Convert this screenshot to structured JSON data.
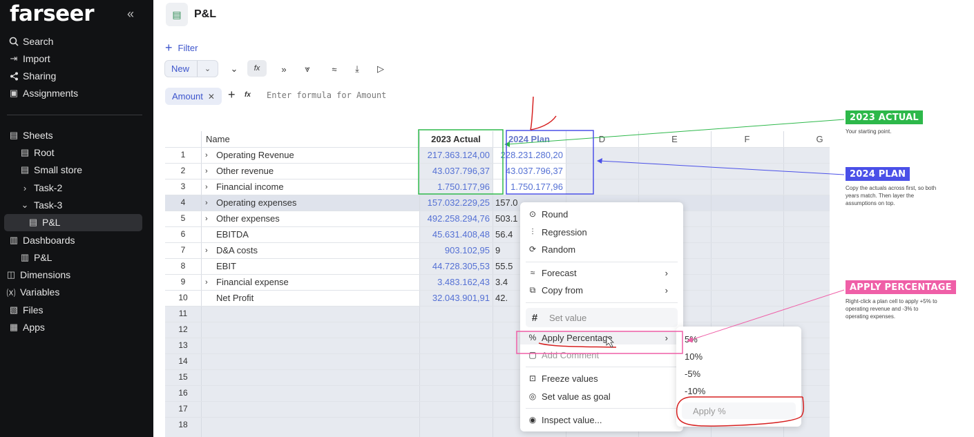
{
  "sidebar": {
    "logo": "farseer",
    "top_items": [
      "Search",
      "Import",
      "Sharing",
      "Assignments"
    ],
    "tree": [
      {
        "label": "Sheets",
        "icon": "sheet-icon"
      },
      {
        "label": "Root",
        "icon": "sheet-icon"
      },
      {
        "label": "Small store",
        "icon": "sheet-icon"
      },
      {
        "label": "Task-2",
        "icon": "chevron-right-icon"
      },
      {
        "label": "Task-3",
        "icon": "chevron-down-icon"
      },
      {
        "label": "P&L",
        "icon": "sheet-icon",
        "active": true
      },
      {
        "label": "Dashboards",
        "icon": "dashboard-icon"
      },
      {
        "label": "P&L",
        "icon": "dashboard-icon"
      },
      {
        "label": "Dimensions",
        "icon": "dimensions-icon"
      },
      {
        "label": "Variables",
        "icon": "variables-icon"
      },
      {
        "label": "Files",
        "icon": "files-icon"
      },
      {
        "label": "Apps",
        "icon": "apps-icon"
      }
    ]
  },
  "header": {
    "title": "P&L"
  },
  "filter_label": "Filter",
  "toolbar": {
    "new_label": "New",
    "fx_label": "fx"
  },
  "formula": {
    "chip": "Amount",
    "fx": "fx",
    "placeholder": "Enter formula for Amount"
  },
  "grid": {
    "columns": [
      "Name",
      "2023 Actual",
      "2024 Plan",
      "D",
      "E",
      "F",
      "G"
    ],
    "rows": [
      {
        "n": "1",
        "name": "Operating Revenue",
        "expand": true,
        "actual": "217.363.124,00",
        "plan": "228.231.280,20"
      },
      {
        "n": "2",
        "name": "Other revenue",
        "expand": true,
        "actual": "43.037.796,37",
        "plan": "43.037.796,37"
      },
      {
        "n": "3",
        "name": "Financial income",
        "expand": true,
        "actual": "1.750.177,96",
        "plan": "1.750.177,96"
      },
      {
        "n": "4",
        "name": "Operating expenses",
        "expand": true,
        "actual": "157.032.229,25",
        "plan": "157.0"
      },
      {
        "n": "5",
        "name": "Other expenses",
        "expand": true,
        "actual": "492.258.294,76",
        "plan": "503.1"
      },
      {
        "n": "6",
        "name": "EBITDA",
        "expand": false,
        "actual": "45.631.408,48",
        "plan": "56.4"
      },
      {
        "n": "7",
        "name": "D&A costs",
        "expand": true,
        "actual": "903.102,95",
        "plan": "9"
      },
      {
        "n": "8",
        "name": "EBIT",
        "expand": false,
        "actual": "44.728.305,53",
        "plan": "55.5"
      },
      {
        "n": "9",
        "name": "Financial expense",
        "expand": true,
        "actual": "3.483.162,43",
        "plan": "3.4"
      },
      {
        "n": "10",
        "name": "Net Profit",
        "expand": false,
        "actual": "32.043.901,91",
        "plan": "42."
      }
    ],
    "empty_rows": [
      "11",
      "12",
      "13",
      "14",
      "15",
      "16",
      "17",
      "18"
    ]
  },
  "context_menu": {
    "items": [
      "Round",
      "Regression",
      "Random",
      "Forecast",
      "Copy from",
      "Set value",
      "Apply Percentage",
      "Add Comment",
      "Freeze values",
      "Set value as goal",
      "Inspect value..."
    ],
    "submenu": [
      "5%",
      "10%",
      "-5%",
      "-10%"
    ],
    "apply_label": "Apply %"
  },
  "annotations": {
    "actual": {
      "tag": "2023 ACTUAL",
      "note": "Your starting point.",
      "color": "#2db84a"
    },
    "plan": {
      "tag": "2024 PLAN",
      "note": "Copy the actuals across first, so both years match. Then layer the assumptions on top.",
      "color": "#4a50e8"
    },
    "percentage": {
      "tag": "APPLY PERCENTAGE",
      "note": "Right-click a plan cell to apply +5% to operating revenue and -3% to operating expenses.",
      "color": "#ef5fa7"
    }
  }
}
